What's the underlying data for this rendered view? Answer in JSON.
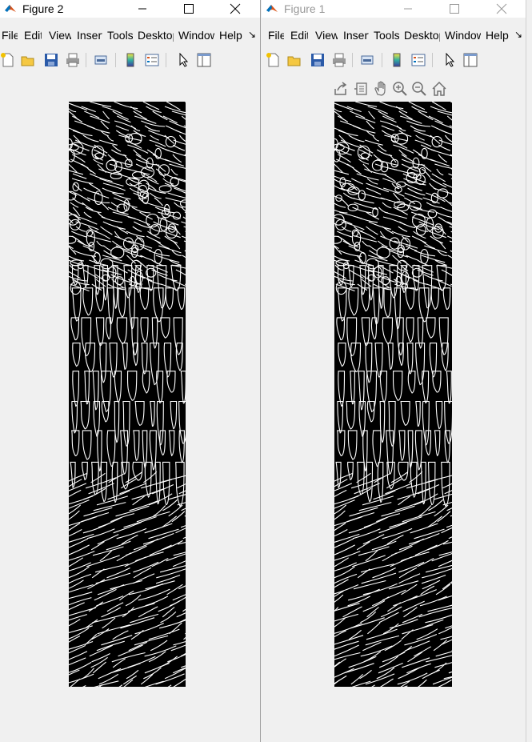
{
  "windows": {
    "figure2": {
      "title": "Figure 2",
      "menu": [
        "File",
        "Edit",
        "View",
        "Insert",
        "Tools",
        "Desktop",
        "Window",
        "Help"
      ],
      "menu_overflow_glyph": "↘"
    },
    "figure1": {
      "title": "Figure 1",
      "menu": [
        "File",
        "Edit",
        "View",
        "Insert",
        "Tools",
        "Desktop",
        "Window",
        "Help"
      ],
      "menu_overflow_glyph": "↘",
      "axes_toolbar": [
        "export-icon",
        "brush-icon",
        "pan-hand-icon",
        "zoom-in-icon",
        "zoom-out-icon",
        "home-icon"
      ]
    }
  },
  "toolbar_icons": [
    "new-figure-icon",
    "open-file-icon",
    "save-icon",
    "print-icon",
    "link-plot-icon",
    "colorbar-icon",
    "legend-icon",
    "edit-plot-pointer-icon",
    "property-inspector-icon"
  ],
  "colors": {
    "titlebar_bg": "#ffffff",
    "window_bg": "#f0f0f0",
    "plot_bg": "#000000",
    "edge_line": "#ffffff",
    "matlab_orange": "#d95319",
    "matlab_blue": "#0072bd"
  },
  "image": {
    "content": "binary edge map",
    "foreground": "white",
    "background": "black"
  }
}
